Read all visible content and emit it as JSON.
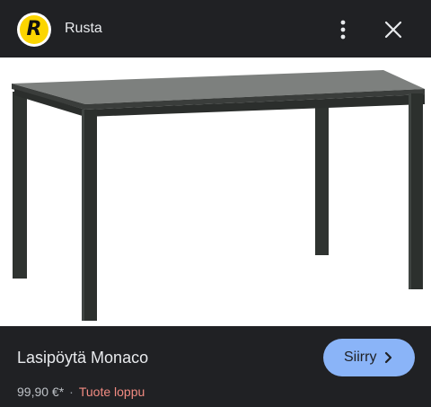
{
  "header": {
    "site_name": "Rusta",
    "logo_letter": "R",
    "logo_color": "#fcd500",
    "more_icon": "more-vert-icon",
    "close_icon": "close-icon"
  },
  "image": {
    "lens_icon": "google-lens-icon"
  },
  "product": {
    "title": "Lasipöytä Monaco",
    "price": "99,90 €*",
    "separator": "·",
    "stock_status": "Tuote loppu",
    "stock_color": "#f28b82",
    "visit_label": "Siirry",
    "visit_icon": "chevron-right-icon",
    "accent": "#8ab4f8"
  }
}
